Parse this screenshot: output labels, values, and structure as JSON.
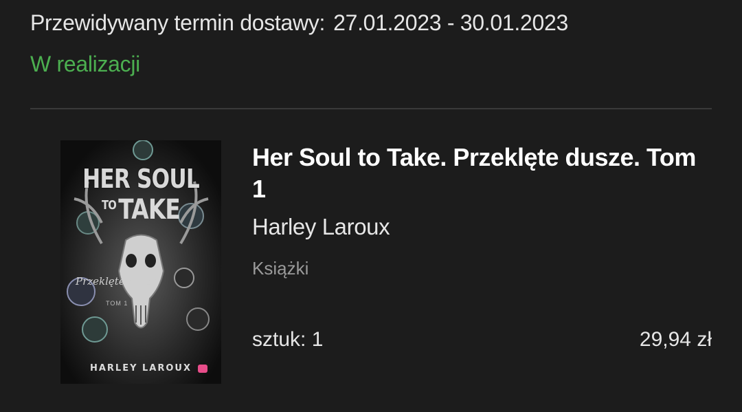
{
  "delivery": {
    "label": "Przewidywany termin dostawy:",
    "date_range": "27.01.2023 - 30.01.2023"
  },
  "order_status": {
    "text": "W realizacji",
    "color": "#4caf50"
  },
  "product": {
    "title": "Her Soul to Take. Przeklęte dusze. Tom 1",
    "author": "Harley Laroux",
    "category": "Książki",
    "quantity_text": "sztuk: 1",
    "price": "29,94 zł",
    "cover": {
      "title_line_1": "HER SOUL",
      "title_line_2_small": "TO",
      "title_line_2": "TAKE",
      "series": "Przeklęte dusze",
      "tom": "TOM 1",
      "author": "HARLEY LAROUX"
    }
  }
}
